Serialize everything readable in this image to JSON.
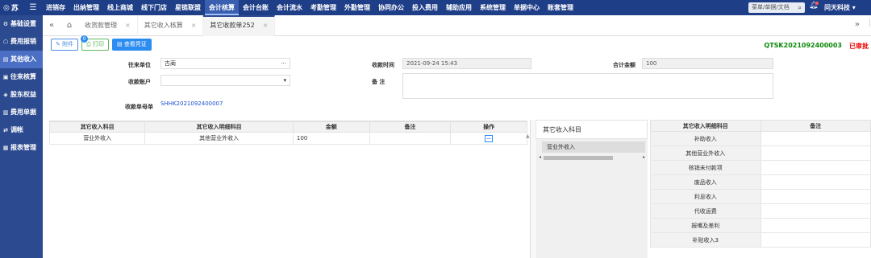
{
  "app": {
    "logo": "苏",
    "menu_icon": "menu-icon"
  },
  "topnav": [
    "进销存",
    "出纳管理",
    "线上商城",
    "线下门店",
    "星链联盟",
    "会计核算",
    "会计台账",
    "会计流水",
    "考勤管理",
    "外勤管理",
    "协同办公",
    "投入费用",
    "辅助应用",
    "系统管理",
    "单据中心",
    "账套管理"
  ],
  "topnav_active_index": 5,
  "search": {
    "placeholder": "菜单/单据/文档"
  },
  "company": "问天科技 ▾",
  "sidebar": [
    "基础设置",
    "费用报销",
    "其他收入",
    "往来核算",
    "股东权益",
    "费用单据",
    "调帐",
    "报表管理"
  ],
  "sidebar_active_index": 2,
  "tabs": [
    {
      "label": "收货款管理",
      "close": "×"
    },
    {
      "label": "其它收入核算",
      "close": "×"
    },
    {
      "label": "其它收款单252",
      "close": "×"
    }
  ],
  "toolbar": {
    "attach": "附件",
    "attach_badge": "0",
    "print": "打印",
    "voucher": "查看凭证"
  },
  "doc": {
    "number": "QTSK2021092400003",
    "status": "已审批"
  },
  "form": {
    "unit_label": "往来单位",
    "unit_value": "古蔺",
    "unit_suffix": "···",
    "account_label": "收款账户",
    "account_value": "",
    "account_suffix": "▾",
    "source_label": "收款单母单",
    "source_value": "SHHK2021092400007",
    "time_label": "收款时间",
    "time_value": "2021-09-24 15:43",
    "memo_label": "备    注",
    "memo_value": "",
    "total_label": "合计金额",
    "total_value": "100"
  },
  "grid": {
    "headers": [
      "其它收入科目",
      "其它收入明细科目",
      "金额",
      "备注",
      "操作"
    ],
    "rows": [
      {
        "subject": "营业外收入",
        "detail": "其他营业外收入",
        "amount": "100",
        "note": "",
        "op": "−"
      }
    ]
  },
  "picker": {
    "title": "其它收入科目",
    "items": [
      "营业外收入"
    ]
  },
  "subgrid": {
    "headers": [
      "其它收入明细科目",
      "备注"
    ],
    "rows": [
      "补助收入",
      "其他营业外收入",
      "核销未付款项",
      "废品收入",
      "利息收入",
      "代收运费",
      "报嘴及差利",
      "补贴收入3"
    ]
  }
}
